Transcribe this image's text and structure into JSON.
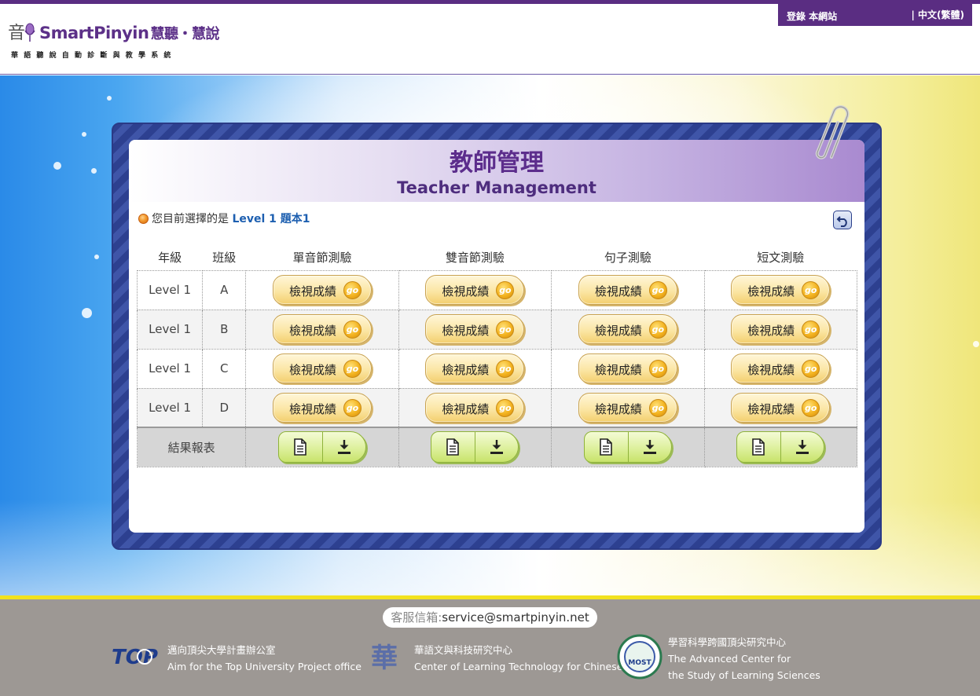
{
  "header": {
    "logo_brand": "SmartPinyin",
    "logo_brand_cn": "慧聽・慧說",
    "logo_subtitle": "華語聽說自動診斷與教學系統",
    "login_label": "登錄 本網站",
    "language_label": "| 中文(繁體)"
  },
  "panel": {
    "title_cn": "教師管理",
    "title_en": "Teacher Management",
    "selection_prefix": "您目前選擇的是",
    "selection_value": "Level 1 題本1",
    "back_icon": "undo-icon"
  },
  "table": {
    "headers": [
      "年級",
      "班級",
      "單音節測驗",
      "雙音節測驗",
      "句子測驗",
      "短文測驗"
    ],
    "rows": [
      {
        "grade": "Level 1",
        "class": "A"
      },
      {
        "grade": "Level 1",
        "class": "B"
      },
      {
        "grade": "Level 1",
        "class": "C"
      },
      {
        "grade": "Level 1",
        "class": "D"
      }
    ],
    "view_button_label": "檢視成績",
    "go_label": "go",
    "report_label": "結果報表",
    "report_icons": [
      "document-icon",
      "download-icon"
    ]
  },
  "footer": {
    "email_label": "客服信箱:",
    "email_value": "service@smartpinyin.net",
    "sponsors": [
      {
        "line1": "邁向頂尖大學計畫辦公室",
        "line2": "Aim for the Top University Project office",
        "logo_text": "TOP"
      },
      {
        "line1": "華語文與科技研究中心",
        "line2": "Center of Learning Technology for Chinese",
        "logo_text": "華"
      },
      {
        "line1": "學習科學跨國頂尖研究中心",
        "line2": "The Advanced Center for",
        "line3": "the Study of Learning Sciences",
        "logo_text": "MOST"
      }
    ]
  },
  "colors": {
    "brand_purple": "#5a2d82",
    "title_purple": "#5c2d8c",
    "link_blue": "#1d5fb0",
    "go_button": "#fbe6a5",
    "download_green": "#ddf09c",
    "footer_gray": "#9d9894",
    "accent_yellow": "#f2e21e"
  }
}
